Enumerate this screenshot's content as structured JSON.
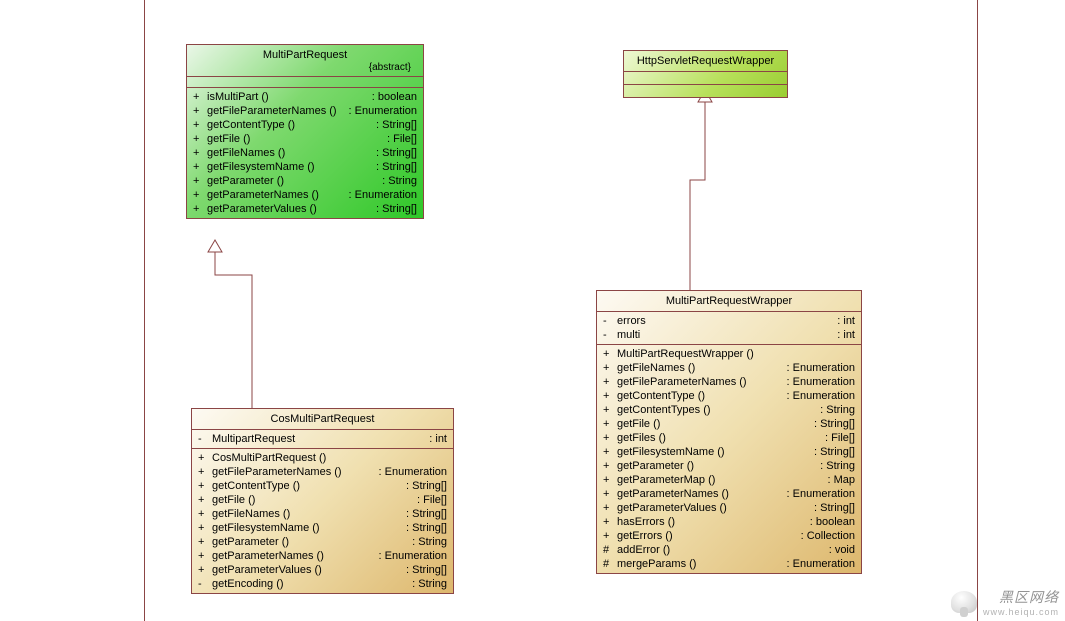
{
  "classes": {
    "multiPartRequest": {
      "name": "MultiPartRequest",
      "stereotype": "{abstract}",
      "ops": [
        {
          "vis": "+",
          "name": "isMultiPart ()",
          "type": "boolean"
        },
        {
          "vis": "+",
          "name": "getFileParameterNames ()",
          "type": "Enumeration"
        },
        {
          "vis": "+",
          "name": "getContentType ()",
          "type": "String[]"
        },
        {
          "vis": "+",
          "name": "getFile ()",
          "type": "File[]"
        },
        {
          "vis": "+",
          "name": "getFileNames ()",
          "type": "String[]"
        },
        {
          "vis": "+",
          "name": "getFilesystemName ()",
          "type": "String[]"
        },
        {
          "vis": "+",
          "name": "getParameter ()",
          "type": "String"
        },
        {
          "vis": "+",
          "name": "getParameterNames ()",
          "type": "Enumeration"
        },
        {
          "vis": "+",
          "name": "getParameterValues ()",
          "type": "String[]"
        }
      ]
    },
    "httpServletRequestWrapper": {
      "name": "HttpServletRequestWrapper"
    },
    "cosMultiPartRequest": {
      "name": "CosMultiPartRequest",
      "attrs": [
        {
          "vis": "-",
          "name": "MultipartRequest",
          "type": "int"
        }
      ],
      "ops": [
        {
          "vis": "+",
          "name": "CosMultiPartRequest ()",
          "type": null
        },
        {
          "vis": "+",
          "name": "getFileParameterNames ()",
          "type": "Enumeration"
        },
        {
          "vis": "+",
          "name": "getContentType ()",
          "type": "String[]"
        },
        {
          "vis": "+",
          "name": "getFile ()",
          "type": "File[]"
        },
        {
          "vis": "+",
          "name": "getFileNames ()",
          "type": "String[]"
        },
        {
          "vis": "+",
          "name": "getFilesystemName ()",
          "type": "String[]"
        },
        {
          "vis": "+",
          "name": "getParameter ()",
          "type": "String"
        },
        {
          "vis": "+",
          "name": "getParameterNames ()",
          "type": "Enumeration"
        },
        {
          "vis": "+",
          "name": "getParameterValues ()",
          "type": "String[]"
        },
        {
          "vis": "-",
          "name": "getEncoding ()",
          "type": "String"
        }
      ]
    },
    "multiPartRequestWrapper": {
      "name": "MultiPartRequestWrapper",
      "attrs": [
        {
          "vis": "-",
          "name": "errors",
          "type": "int"
        },
        {
          "vis": "-",
          "name": "multi",
          "type": "int"
        }
      ],
      "ops": [
        {
          "vis": "+",
          "name": "MultiPartRequestWrapper ()",
          "type": null
        },
        {
          "vis": "+",
          "name": "getFileNames ()",
          "type": "Enumeration"
        },
        {
          "vis": "+",
          "name": "getFileParameterNames ()",
          "type": "Enumeration"
        },
        {
          "vis": "+",
          "name": "getContentType ()",
          "type": "Enumeration"
        },
        {
          "vis": "+",
          "name": "getContentTypes ()",
          "type": "String"
        },
        {
          "vis": "+",
          "name": "getFile ()",
          "type": "String[]"
        },
        {
          "vis": "+",
          "name": "getFiles ()",
          "type": "File[]"
        },
        {
          "vis": "+",
          "name": "getFilesystemName ()",
          "type": "String[]"
        },
        {
          "vis": "+",
          "name": "getParameter ()",
          "type": "String"
        },
        {
          "vis": "+",
          "name": "getParameterMap ()",
          "type": "Map"
        },
        {
          "vis": "+",
          "name": "getParameterNames ()",
          "type": "Enumeration"
        },
        {
          "vis": "+",
          "name": "getParameterValues ()",
          "type": "String[]"
        },
        {
          "vis": "+",
          "name": "hasErrors ()",
          "type": "boolean"
        },
        {
          "vis": "+",
          "name": "getErrors ()",
          "type": "Collection"
        },
        {
          "vis": "#",
          "name": "addError ()",
          "type": "void"
        },
        {
          "vis": "#",
          "name": "mergeParams ()",
          "type": "Enumeration"
        }
      ]
    }
  },
  "watermark": {
    "main": "黑区网络",
    "sub": "www.heiqu.com"
  }
}
